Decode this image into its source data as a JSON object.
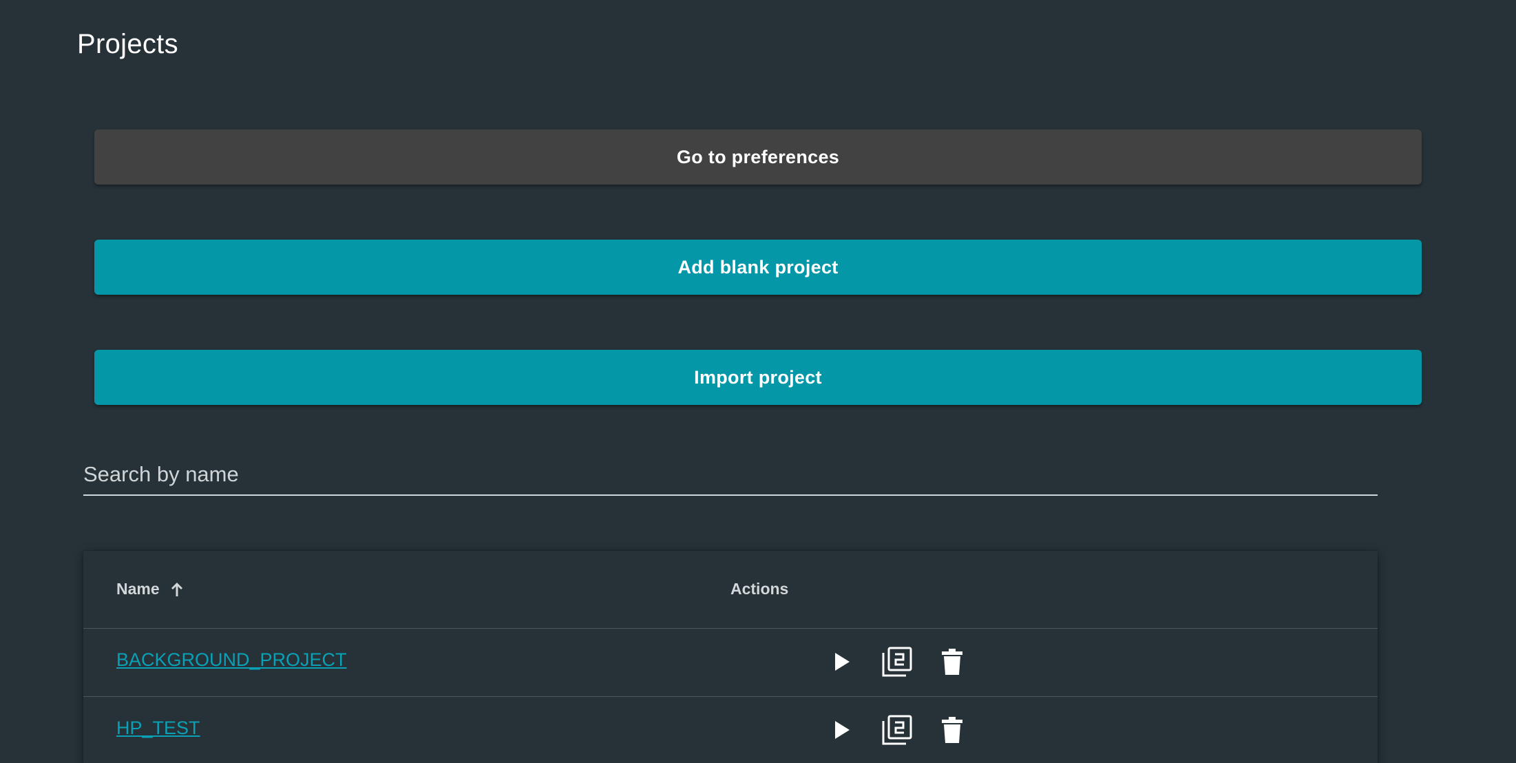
{
  "page": {
    "title": "Projects"
  },
  "buttons": {
    "preferences_label": "Go to preferences",
    "add_blank_label": "Add blank project",
    "import_label": "Import project"
  },
  "search": {
    "placeholder": "Search by name",
    "value": ""
  },
  "table": {
    "columns": {
      "name": "Name",
      "actions": "Actions"
    },
    "sort": {
      "column": "Name",
      "direction": "ascending",
      "icon": "arrow-up-icon"
    },
    "rows": [
      {
        "name": "BACKGROUND_PROJECT",
        "actions": [
          "play-icon",
          "duplicate-icon",
          "delete-icon"
        ]
      },
      {
        "name": "HP_TEST",
        "actions": [
          "play-icon",
          "duplicate-icon",
          "delete-icon"
        ]
      }
    ]
  },
  "colors": {
    "background": "#263238",
    "primary": "#0397a7",
    "secondary_button": "#424242",
    "link": "#0aa0b5"
  }
}
